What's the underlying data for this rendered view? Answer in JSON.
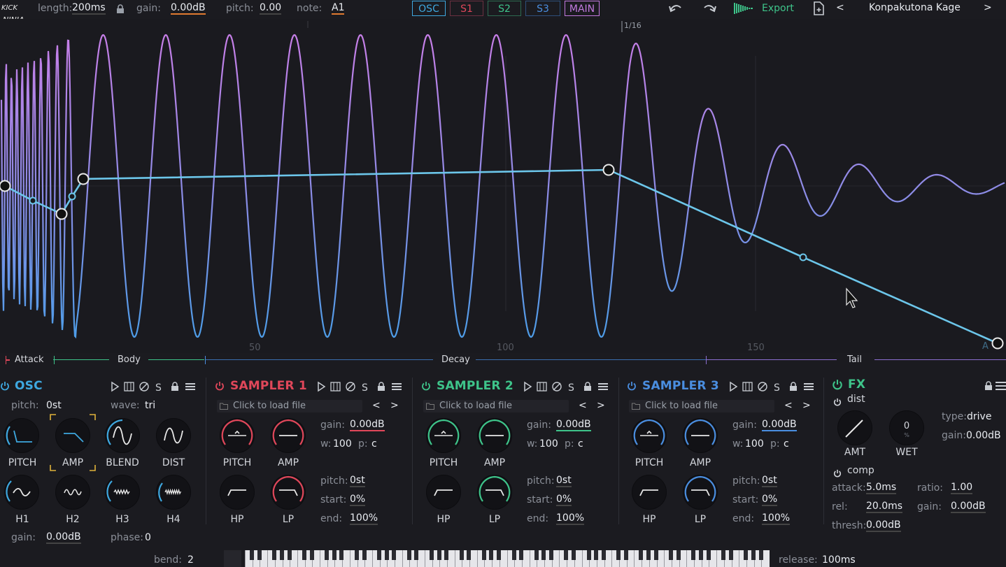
{
  "topbar": {
    "length_label": "length:",
    "length_value": "200ms",
    "gain_label": "gain:",
    "gain_value": "0.00dB",
    "pitch_label": "pitch:",
    "pitch_value": "0.00",
    "note_label": "note:",
    "note_value": "A1",
    "tabs": [
      "OSC",
      "S1",
      "S2",
      "S3",
      "MAIN"
    ],
    "export_label": "Export",
    "preset_prev": "<",
    "preset_next": ">",
    "preset_name": "Konpakutona Kage",
    "logo_text": "KICK NINJA"
  },
  "wave": {
    "grid_marker": "1/16",
    "x_ticks": [
      "50",
      "100",
      "150"
    ],
    "corner_label": "A"
  },
  "segments": [
    "Attack",
    "Body",
    "Decay",
    "Tail"
  ],
  "osc": {
    "title": "OSC",
    "pitch_label": "pitch:",
    "pitch_value": "0st",
    "wave_label": "wave:",
    "wave_value": "tri",
    "knobs_row1": [
      "PITCH",
      "AMP",
      "BLEND",
      "DIST"
    ],
    "knobs_row2": [
      "H1",
      "H2",
      "H3",
      "H4"
    ],
    "gain_label": "gain:",
    "gain_value": "0.00dB",
    "phase_label": "phase:",
    "phase_value": "0",
    "header_icons": [
      "play-icon",
      "grid-icon",
      "disable-icon",
      "S",
      "lock-icon",
      "menu-icon"
    ]
  },
  "samplers": [
    {
      "title": "SAMPLER 1",
      "color": "#e0475a",
      "load": "Click to load file",
      "gain_label": "gain:",
      "gain_value": "0.00dB",
      "w_label": "w:",
      "w_value": "100",
      "p_label": "p:",
      "p_value": "c",
      "pitch_label": "pitch:",
      "pitch_value": "0st",
      "start_label": "start:",
      "start_value": "0%",
      "end_label": "end:",
      "end_value": "100%",
      "knobs": [
        "PITCH",
        "AMP",
        "HP",
        "LP"
      ],
      "nav_prev": "<",
      "nav_next": ">"
    },
    {
      "title": "SAMPLER 2",
      "color": "#3ec48a",
      "load": "Click to load file",
      "gain_label": "gain:",
      "gain_value": "0.00dB",
      "w_label": "w:",
      "w_value": "100",
      "p_label": "p:",
      "p_value": "c",
      "pitch_label": "pitch:",
      "pitch_value": "0st",
      "start_label": "start:",
      "start_value": "0%",
      "end_label": "end:",
      "end_value": "100%",
      "knobs": [
        "PITCH",
        "AMP",
        "HP",
        "LP"
      ],
      "nav_prev": "<",
      "nav_next": ">"
    },
    {
      "title": "SAMPLER 3",
      "color": "#4a8ee0",
      "load": "Click to load file",
      "gain_label": "gain:",
      "gain_value": "0.00dB",
      "w_label": "w:",
      "w_value": "100",
      "p_label": "p:",
      "p_value": "c",
      "pitch_label": "pitch:",
      "pitch_value": "0st",
      "start_label": "start:",
      "start_value": "0%",
      "end_label": "end:",
      "end_value": "100%",
      "knobs": [
        "PITCH",
        "AMP",
        "HP",
        "LP"
      ],
      "nav_prev": "<",
      "nav_next": ">"
    }
  ],
  "fx": {
    "title": "FX",
    "dist_label": "dist",
    "amt_label": "AMT",
    "wet_label": "WET",
    "wet_value": "0",
    "wet_unit": "%",
    "type_label": "type:",
    "type_value": "drive",
    "gain_label": "gain:",
    "gain_value": "0.00dB",
    "comp_label": "comp",
    "attack_label": "attack:",
    "attack_value": "5.0ms",
    "ratio_label": "ratio:",
    "ratio_value": "1.00",
    "rel_label": "rel:",
    "rel_value": "20.0ms",
    "cgain_label": "gain:",
    "cgain_value": "0.00dB",
    "thresh_label": "thresh:",
    "thresh_value": "0.00dB"
  },
  "bottom": {
    "bend_label": "bend:",
    "bend_value": "2",
    "release_label": "release:",
    "release_value": "100ms"
  },
  "colors": {
    "osc": "#3ea8e0",
    "s1": "#e0475a",
    "s2": "#3ec48a",
    "s3": "#4a8ee0",
    "main": "#c27ae0",
    "fx": "#3ec48a",
    "envelope": "#6cc6ea"
  }
}
